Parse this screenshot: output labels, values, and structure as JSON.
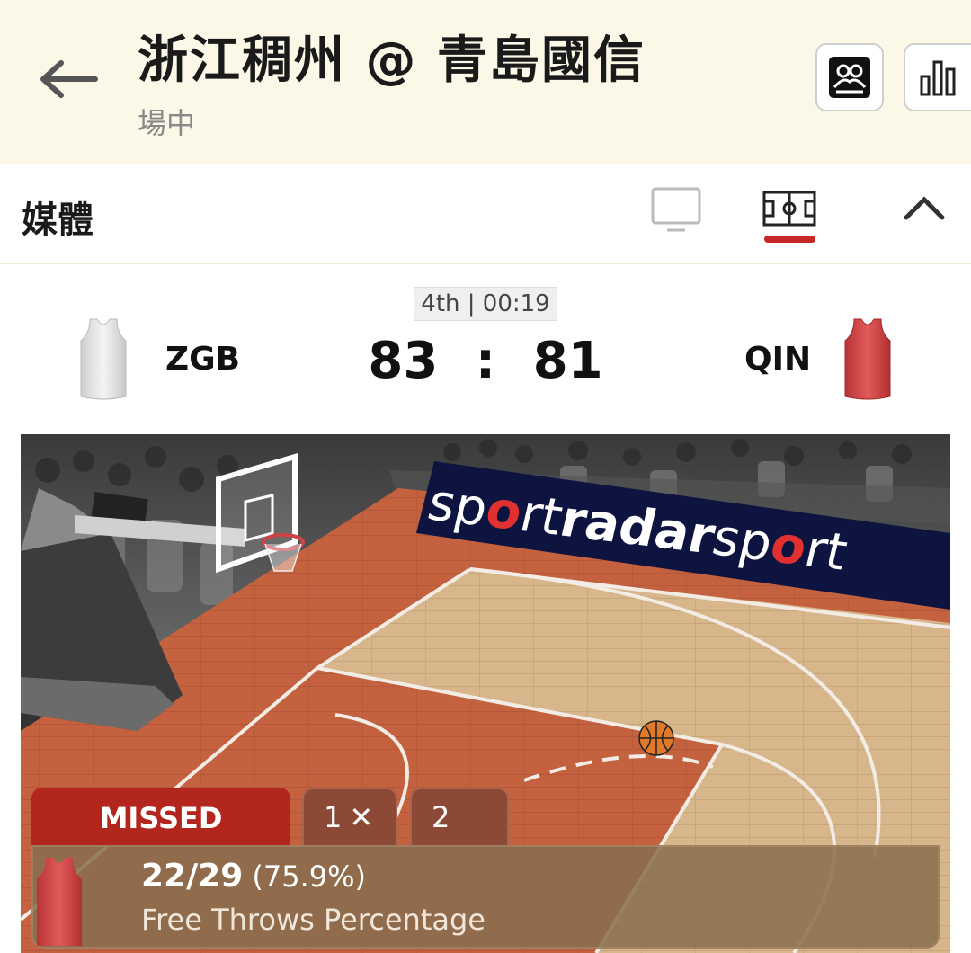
{
  "header": {
    "title": "浙江稠州 @ 青島國信",
    "status": "場中",
    "icons": {
      "back": "arrow-left-icon",
      "lineup": "lineup-icon",
      "stats": "bar-chart-icon"
    }
  },
  "media": {
    "title": "媒體",
    "icons": {
      "tv": "tv-icon",
      "court": "court-icon",
      "collapse": "chevron-up-icon"
    },
    "active_color": "#c62828"
  },
  "scoreboard": {
    "period_clock": "4th | 00:19",
    "home": {
      "abbr": "ZGB",
      "score": "83",
      "jersey_color": "#e6e6e6"
    },
    "away": {
      "abbr": "QIN",
      "score": "81",
      "jersey_color": "#d94848"
    },
    "separator": ":"
  },
  "court": {
    "banner_text_light": "sp",
    "banner_o": "o",
    "banner_text_mid": "rt",
    "banner_text_bold": "radar",
    "banner_text_light2": "sp",
    "banner_text_end": "rt",
    "floor_color": "#c4623f",
    "paint_color": "#d9b48a"
  },
  "event": {
    "result": "MISSED",
    "attempt1": "1",
    "attempt1_mark": "✕",
    "attempt2": "2",
    "stat_value": "22/29",
    "stat_pct": "(75.9%)",
    "stat_label": "Free Throws Percentage"
  }
}
